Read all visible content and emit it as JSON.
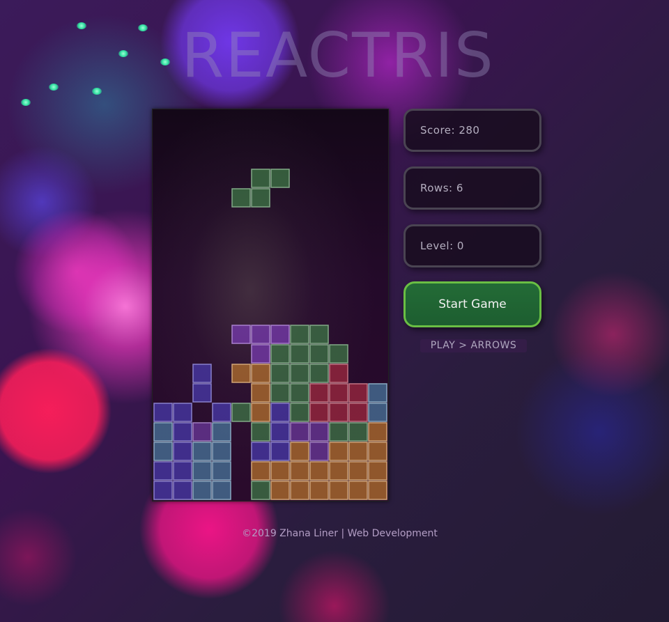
{
  "app": {
    "title": "REACTRIS"
  },
  "stats": {
    "score": "Score: 280",
    "rows": "Rows: 6",
    "level": "Level: 0"
  },
  "controls": {
    "start_label": "Start Game",
    "hint": "PLAY > ARROWS"
  },
  "footer": {
    "text": "©2019 Zhana Liner | Web Development"
  },
  "colors": {
    "P": "#7a3cb4",
    "G": "#3f7a46",
    "R": "#a32a40",
    "O": "#b8742c",
    "B": "#4a3cb0",
    "C": "#4a7aa0",
    "M": "#6e3aa0"
  },
  "board": {
    "columns": 12,
    "rows": 20,
    "active_piece": {
      "shape": "S",
      "color": "G",
      "cells": [
        [
          5,
          3
        ],
        [
          6,
          3
        ],
        [
          4,
          4
        ],
        [
          5,
          4
        ]
      ]
    },
    "grid": [
      "............",
      "............",
      "............",
      "............",
      "............",
      "............",
      "............",
      "............",
      "............",
      "............",
      "............",
      "....PPPGG...",
      ".....PGGGG..",
      "..B.OOGGGR..",
      "..B..OGGRRRC",
      "BB.BGOBGRRRC",
      "CBMC.GBMMGGO",
      "CBCC.BBOMOOO",
      "BBCC.OOOOOOO",
      "BBCC.GOOOOOO"
    ]
  }
}
